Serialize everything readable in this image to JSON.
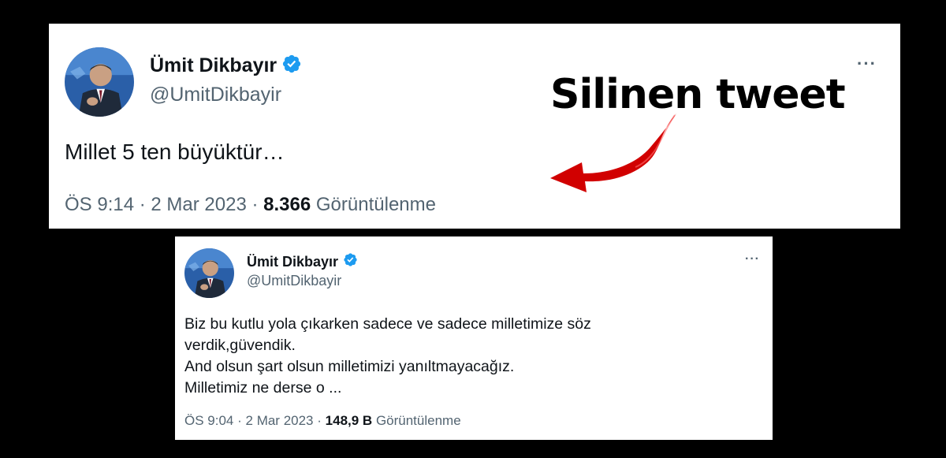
{
  "tweets": [
    {
      "display_name": "Ümit Dikbayır",
      "handle": "@UmitDikbayir",
      "more_label": "···",
      "body_lines": [
        "Millet 5 ten büyüktür…"
      ],
      "time": "ÖS 9:14",
      "separator": "·",
      "date": "2 Mar 2023",
      "views_count": "8.366",
      "views_label": "Görüntülenme"
    },
    {
      "display_name": "Ümit Dikbayır",
      "handle": "@UmitDikbayir",
      "more_label": "···",
      "body_lines": [
        "Biz bu kutlu yola çıkarken sadece ve sadece milletimize söz",
        "verdik,güvendik.",
        "And olsun şart olsun milletimizi yanıltmayacağız.",
        "Milletimiz ne derse o ..."
      ],
      "time": "ÖS 9:04",
      "separator": "·",
      "date": "2 Mar 2023",
      "views_count": "148,9 B",
      "views_label": "Görüntülenme"
    }
  ],
  "annotation": {
    "text": "Silinen tweet",
    "arrow_color": "#d10000"
  },
  "icons": {
    "verified": "verified-badge-icon",
    "more": "more-options-icon",
    "avatar": "profile-photo"
  },
  "colors": {
    "verified": "#1d9bf0",
    "text_primary": "#0f1419",
    "text_secondary": "#536471",
    "background": "#000000"
  }
}
